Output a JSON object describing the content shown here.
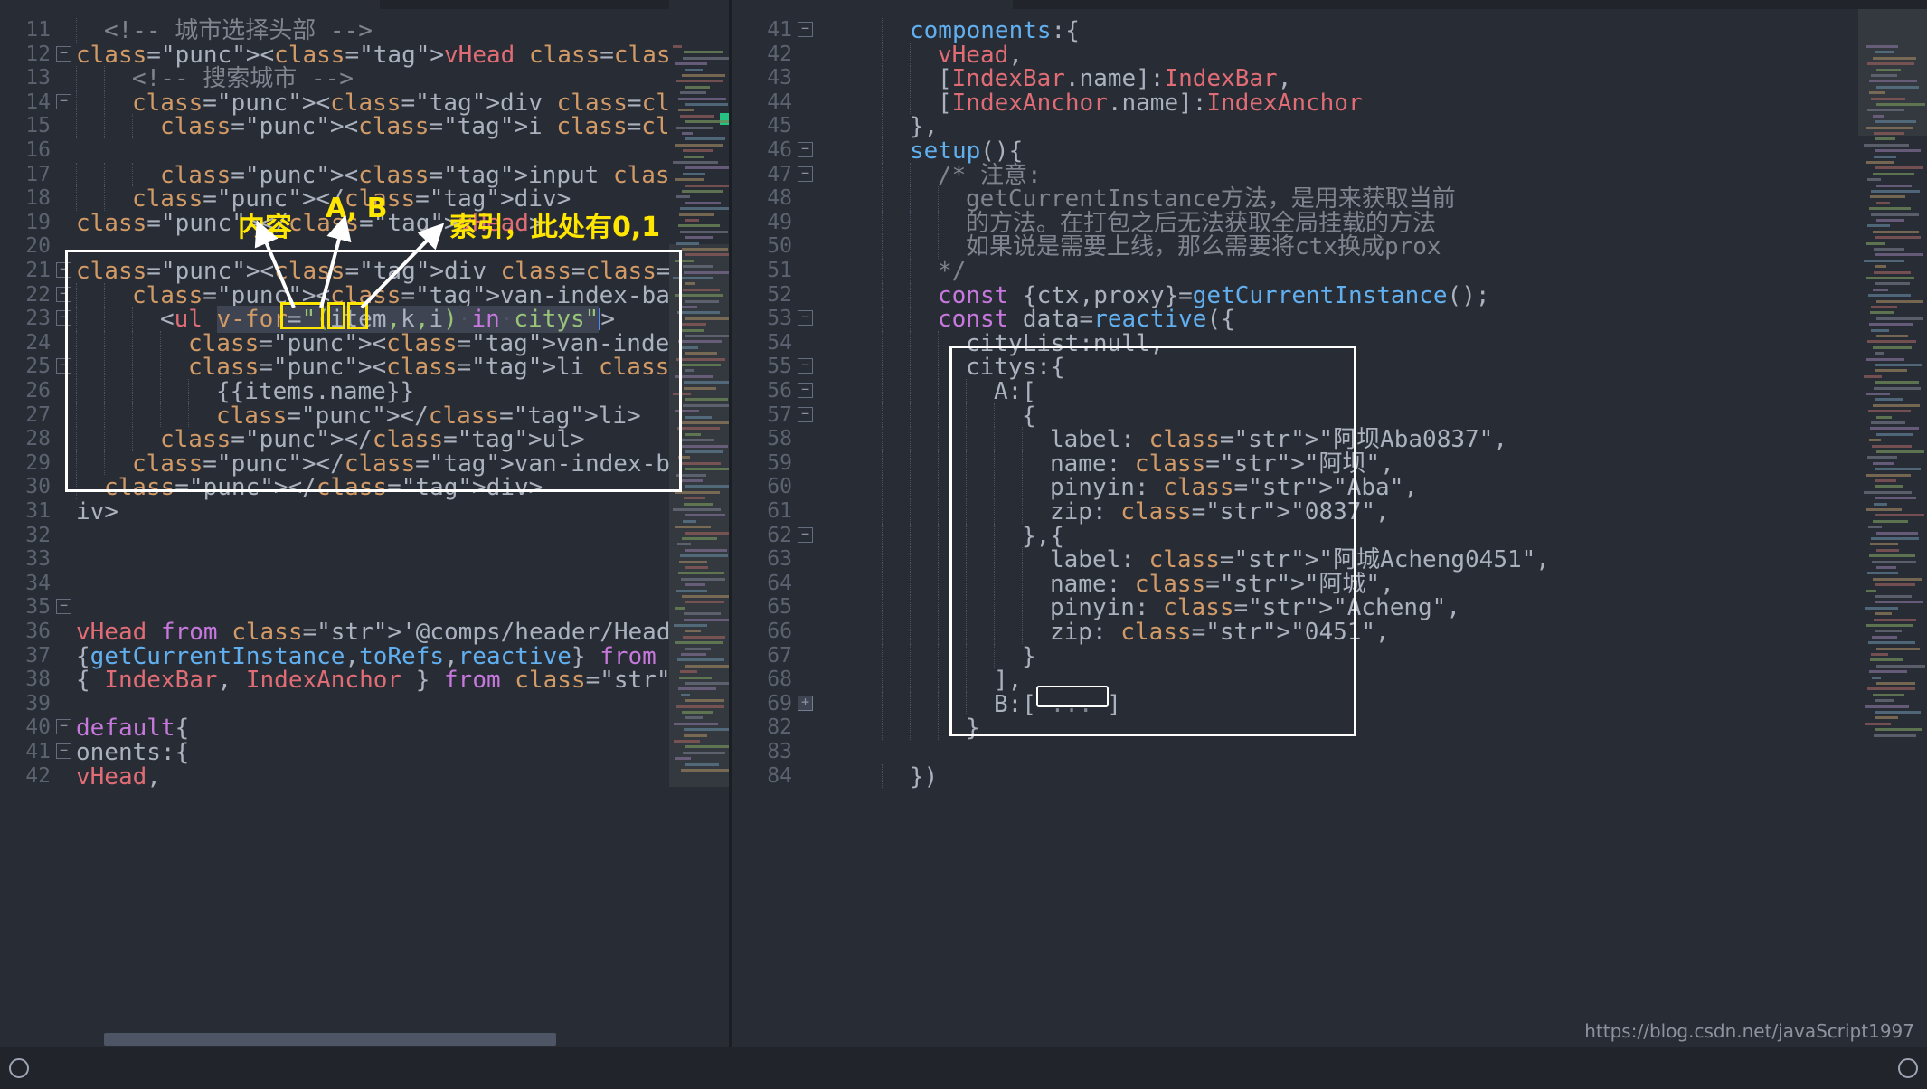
{
  "app": {
    "theme_bg": "#282c34",
    "accent_yellow": "#ffe600",
    "watermark": "https://blog.csdn.net/javaScript1997"
  },
  "tabs": {
    "left_tab_label": "",
    "right_tab_label": ""
  },
  "left_editor": {
    "first_line": 11,
    "lines": [
      {
        "n": 11,
        "fold": "",
        "text": "<!-- 城市选择头部 -->",
        "indent": 1
      },
      {
        "n": 12,
        "fold": "minus",
        "text": "<vHead class=\"city_header\" title=\"城市选择\">",
        "indent": 0
      },
      {
        "n": 13,
        "fold": "",
        "text": "<!-- 搜索城市 -->",
        "indent": 2
      },
      {
        "n": 14,
        "fold": "minus",
        "text": "<div class=\"city_search flex\">",
        "indent": 2
      },
      {
        "n": 15,
        "fold": "",
        "text": "<i class=\"iconfont icon-icon_sousuo\"></i>",
        "indent": 3
      },
      {
        "n": 16,
        "fold": "",
        "text": "",
        "indent": 0
      },
      {
        "n": 17,
        "fold": "",
        "text": "<input class=\"cinput\" type=\"text\" placeholder=\"请输",
        "indent": 3
      },
      {
        "n": 18,
        "fold": "",
        "text": "</div>",
        "indent": 2
      },
      {
        "n": 19,
        "fold": "",
        "text": "</vHead>",
        "indent": 0
      },
      {
        "n": 20,
        "fold": "",
        "text": "",
        "indent": 0
      },
      {
        "n": 21,
        "fold": "minus",
        "text": "<div class=\"city_mian\">",
        "indent": 0
      },
      {
        "n": 22,
        "fold": "minus",
        "text": "<van-index-bar>",
        "indent": 2
      },
      {
        "n": 23,
        "fold": "minus",
        "text": "<ul v-for=\"(item,k,i) in citys\">",
        "indent": 3
      },
      {
        "n": 24,
        "fold": "",
        "text": "<van-index-anchor :index=\"k\" />",
        "indent": 4
      },
      {
        "n": 25,
        "fold": "minus",
        "text": "<li class=\"add_list\" v-for=\"(items,i) in item\"",
        "indent": 4
      },
      {
        "n": 26,
        "fold": "",
        "text": "{{items.name}}",
        "indent": 5
      },
      {
        "n": 27,
        "fold": "",
        "text": "</li>",
        "indent": 5
      },
      {
        "n": 28,
        "fold": "",
        "text": "</ul>",
        "indent": 3
      },
      {
        "n": 29,
        "fold": "",
        "text": "</van-index-bar>",
        "indent": 2
      },
      {
        "n": 30,
        "fold": "",
        "text": "</div>",
        "indent": 1
      },
      {
        "n": 31,
        "fold": "",
        "text": "iv>",
        "indent": 0
      },
      {
        "n": 32,
        "fold": "",
        "text": "",
        "indent": 0
      },
      {
        "n": 33,
        "fold": "",
        "text": "",
        "indent": 0
      },
      {
        "n": 34,
        "fold": "",
        "text": "",
        "indent": 0
      },
      {
        "n": 35,
        "fold": "minus",
        "text": "",
        "indent": 0
      },
      {
        "n": 36,
        "fold": "",
        "text": "vHead from '@comps/header/Header.vue'",
        "indent": 0
      },
      {
        "n": 37,
        "fold": "",
        "text": "{getCurrentInstance,toRefs,reactive} from 'vue'",
        "indent": 0
      },
      {
        "n": 38,
        "fold": "",
        "text": "{ IndexBar, IndexAnchor } from 'vant';",
        "indent": 0
      },
      {
        "n": 39,
        "fold": "",
        "text": "",
        "indent": 0
      },
      {
        "n": 40,
        "fold": "minus",
        "text": "default{",
        "indent": 0
      },
      {
        "n": 41,
        "fold": "minus",
        "text": "onents:{",
        "indent": 0
      },
      {
        "n": 42,
        "fold": "",
        "text": "vHead,",
        "indent": 0
      }
    ],
    "vfor_line": {
      "prefix": "<ul ",
      "selected": "v-for=\"(item,k,i) in citys\"",
      "suffix": ">"
    }
  },
  "right_editor": {
    "lines": [
      {
        "n": 41,
        "fold": "minus",
        "text": "components:{"
      },
      {
        "n": 42,
        "fold": "",
        "text": "vHead,"
      },
      {
        "n": 43,
        "fold": "",
        "text": "[IndexBar.name]:IndexBar,"
      },
      {
        "n": 44,
        "fold": "",
        "text": "[IndexAnchor.name]:IndexAnchor"
      },
      {
        "n": 45,
        "fold": "",
        "text": "},"
      },
      {
        "n": 46,
        "fold": "minus",
        "text": "setup(){"
      },
      {
        "n": 47,
        "fold": "minus",
        "text": "/* 注意:"
      },
      {
        "n": 48,
        "fold": "",
        "text": "getCurrentInstance方法，是用来获取当前"
      },
      {
        "n": 49,
        "fold": "",
        "text": "的方法。在打包之后无法获取全局挂载的方法"
      },
      {
        "n": 50,
        "fold": "",
        "text": "如果说是需要上线，那么需要将ctx换成prox"
      },
      {
        "n": 51,
        "fold": "",
        "text": "*/"
      },
      {
        "n": 52,
        "fold": "",
        "text": "const {ctx,proxy}=getCurrentInstance();"
      },
      {
        "n": 53,
        "fold": "minus",
        "text": "const data=reactive({"
      },
      {
        "n": 54,
        "fold": "",
        "text": "cityList:null,"
      },
      {
        "n": 55,
        "fold": "minus",
        "text": "citys:{"
      },
      {
        "n": 56,
        "fold": "minus",
        "text": "A:["
      },
      {
        "n": 57,
        "fold": "minus",
        "text": "{"
      },
      {
        "n": 58,
        "fold": "",
        "text": "label: \"阿坝Aba0837\","
      },
      {
        "n": 59,
        "fold": "",
        "text": "name: \"阿坝\","
      },
      {
        "n": 60,
        "fold": "",
        "text": "pinyin: \"Aba\","
      },
      {
        "n": 61,
        "fold": "",
        "text": "zip: \"0837\","
      },
      {
        "n": 62,
        "fold": "minus",
        "text": "},{"
      },
      {
        "n": 63,
        "fold": "",
        "text": "label: \"阿城Acheng0451\","
      },
      {
        "n": 64,
        "fold": "",
        "text": "name: \"阿城\","
      },
      {
        "n": 65,
        "fold": "",
        "text": "pinyin: \"Acheng\","
      },
      {
        "n": 66,
        "fold": "",
        "text": "zip: \"0451\","
      },
      {
        "n": 67,
        "fold": "",
        "text": "}"
      },
      {
        "n": 68,
        "fold": "",
        "text": "],"
      },
      {
        "n": 69,
        "fold": "plus",
        "text": "B:[ ... ]"
      },
      {
        "n": 82,
        "fold": "",
        "text": "}"
      },
      {
        "n": 83,
        "fold": "",
        "text": ""
      },
      {
        "n": 84,
        "fold": "",
        "text": "})"
      }
    ],
    "collapsed_placeholder": "..."
  },
  "annotations": {
    "label_content": "内容",
    "label_ab": "A, B",
    "label_index": "索引，此处有0,1",
    "boxes": [
      {
        "name": "item-box"
      },
      {
        "name": "k-box"
      },
      {
        "name": "i-box"
      }
    ]
  },
  "statusbar": {
    "items": [
      {
        "name": "error-count",
        "label": ""
      },
      {
        "name": "cursor-position",
        "label": ""
      }
    ]
  }
}
